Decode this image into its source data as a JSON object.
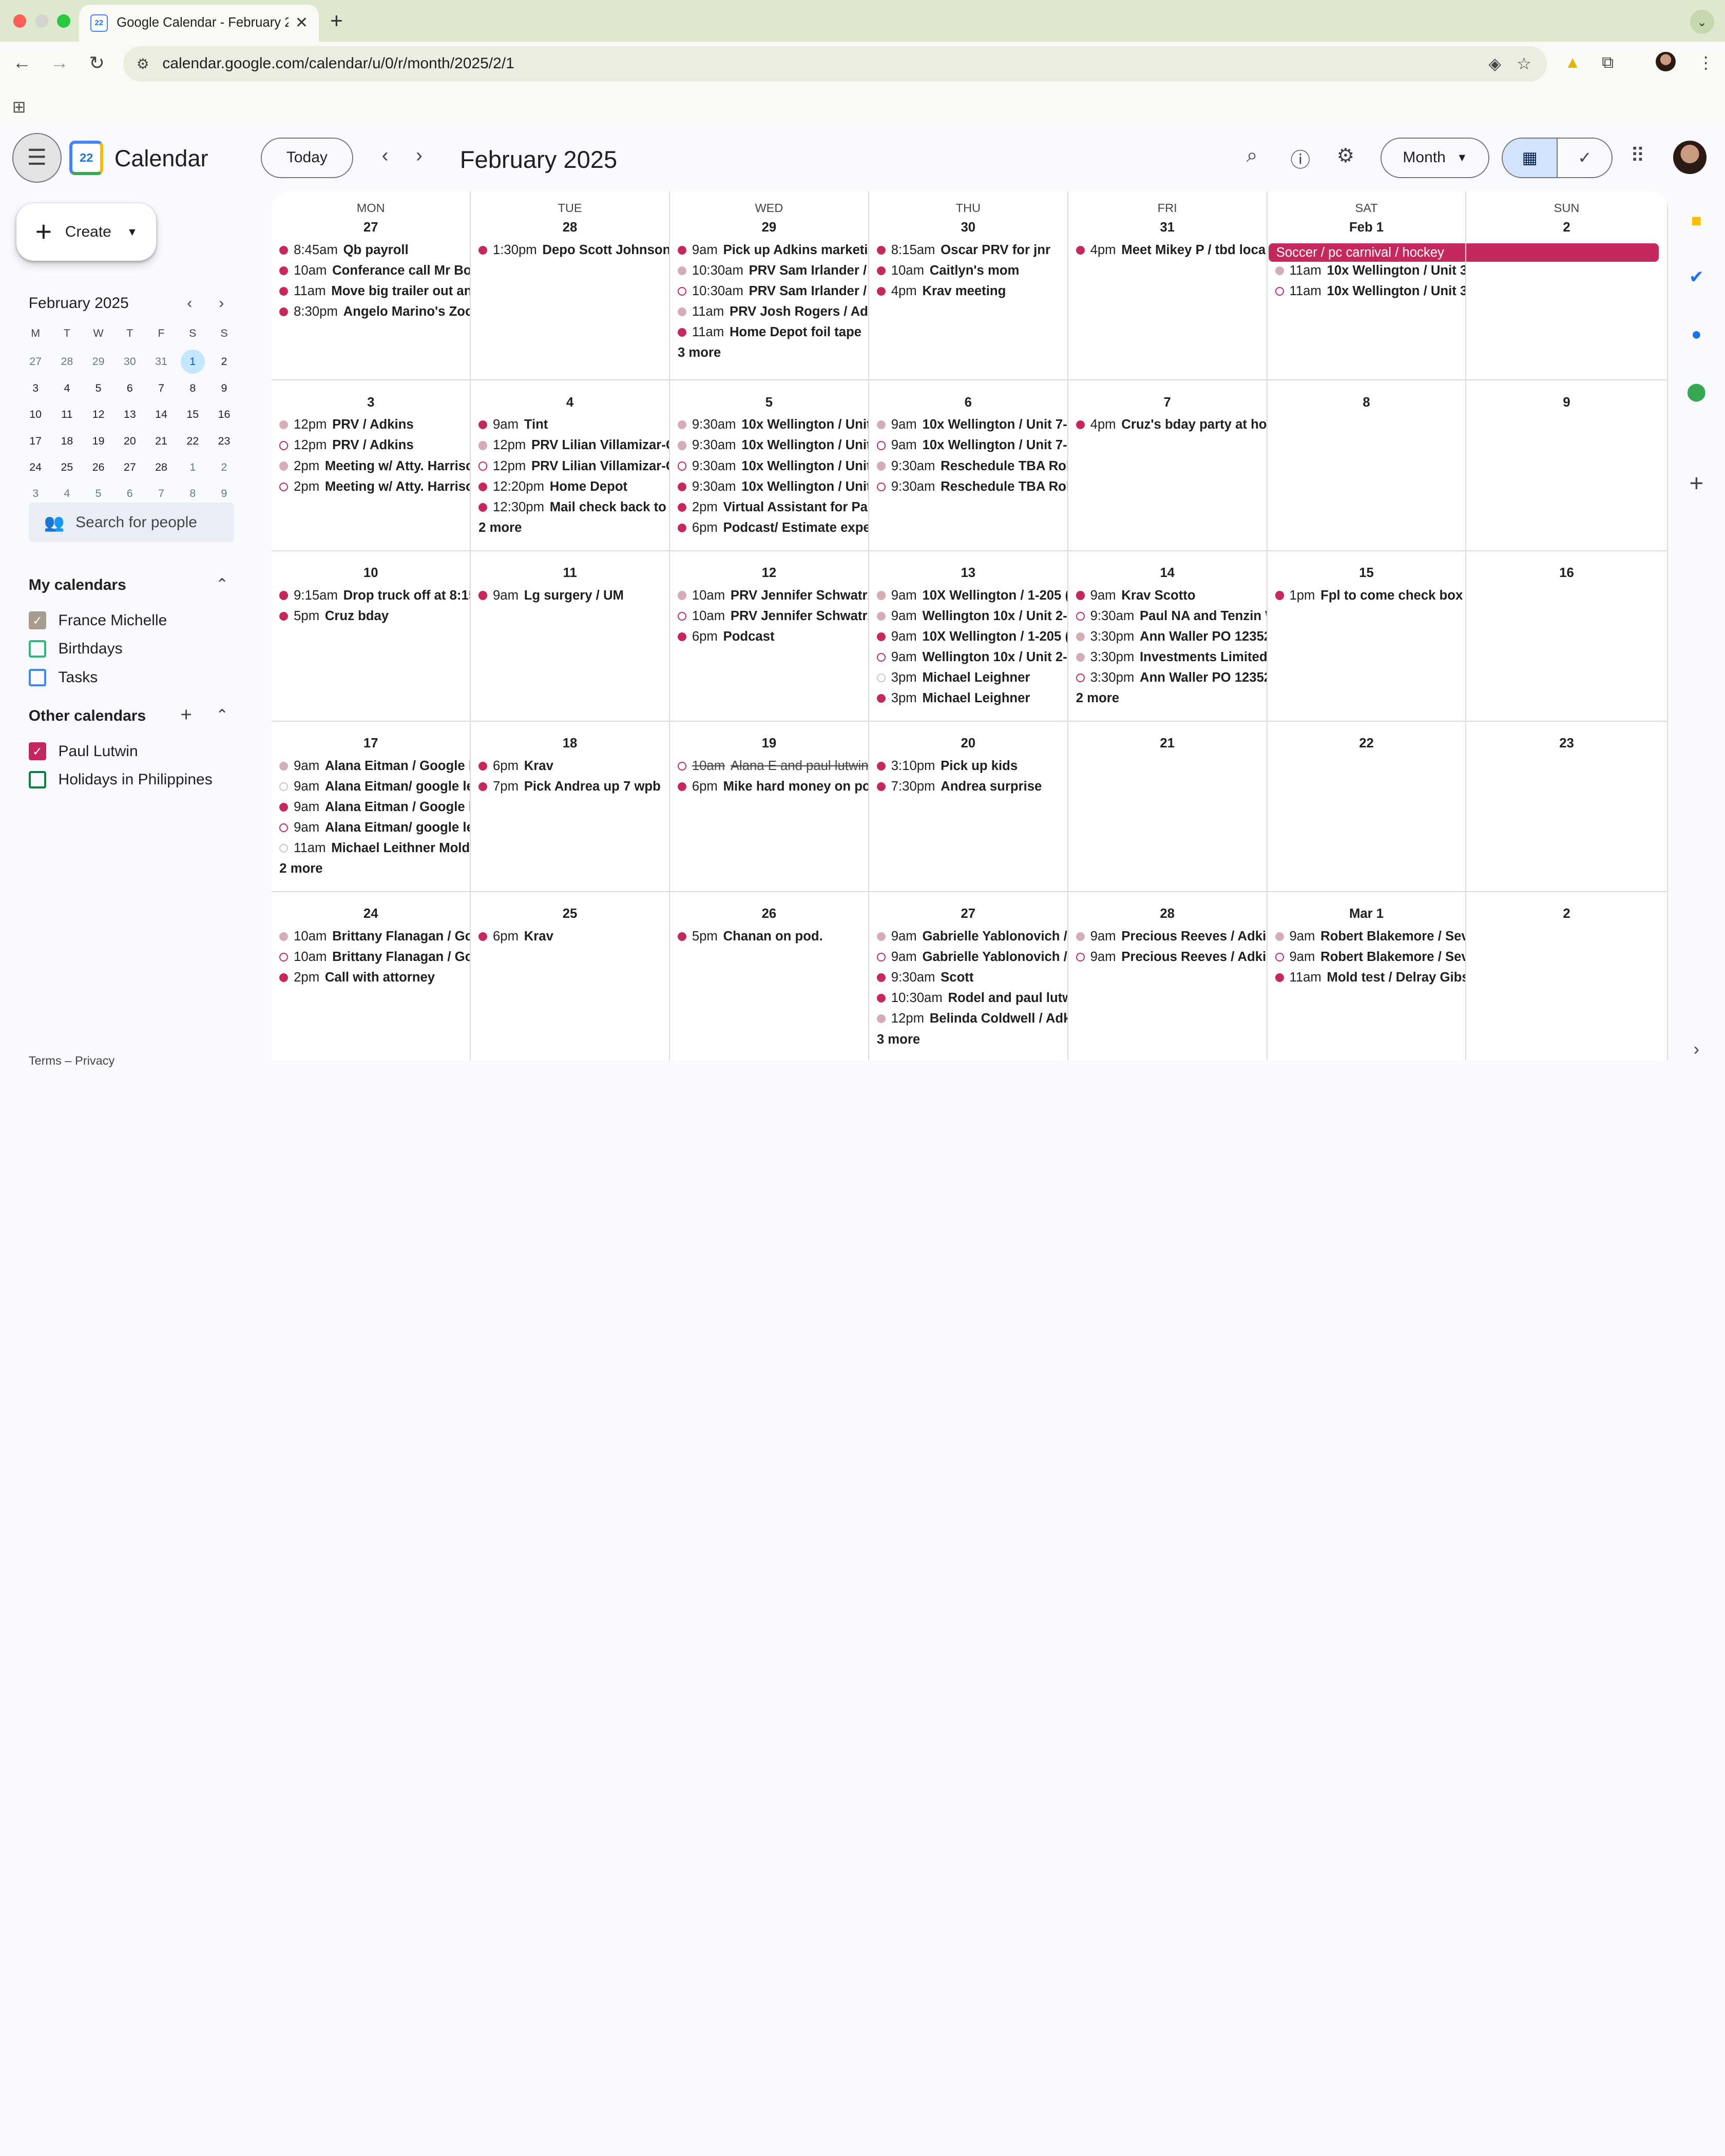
{
  "browser": {
    "tab_title": "Google Calendar - February 2025",
    "tab_favicon": "22",
    "url": "calendar.google.com/calendar/u/0/r/month/2025/2/1"
  },
  "header": {
    "brand": "Calendar",
    "logo_text": "22",
    "today_label": "Today",
    "title": "February 2025",
    "view_label": "Month"
  },
  "sidebar": {
    "create_label": "Create",
    "mini": {
      "title": "February 2025",
      "weekdays": [
        "M",
        "T",
        "W",
        "T",
        "F",
        "S",
        "S"
      ],
      "weeks": [
        [
          "27",
          "28",
          "29",
          "30",
          "31",
          "1",
          "2"
        ],
        [
          "3",
          "4",
          "5",
          "6",
          "7",
          "8",
          "9"
        ],
        [
          "10",
          "11",
          "12",
          "13",
          "14",
          "15",
          "16"
        ],
        [
          "17",
          "18",
          "19",
          "20",
          "21",
          "22",
          "23"
        ],
        [
          "24",
          "25",
          "26",
          "27",
          "28",
          "1",
          "2"
        ],
        [
          "3",
          "4",
          "5",
          "6",
          "7",
          "8",
          "9"
        ]
      ],
      "dim_first_row_count": 5,
      "dim_last_row_from": 5,
      "selected": "1"
    },
    "search_people_placeholder": "Search for people",
    "my_calendars_title": "My calendars",
    "my_calendars": [
      {
        "label": "France Michelle",
        "color": "#a79b8e",
        "checked": true
      },
      {
        "label": "Birthdays",
        "color": "#33b679",
        "checked": false
      },
      {
        "label": "Tasks",
        "color": "#4285f4",
        "checked": false
      }
    ],
    "other_calendars_title": "Other calendars",
    "other_calendars": [
      {
        "label": "Paul Lutwin",
        "color": "#c5285e",
        "checked": true
      },
      {
        "label": "Holidays in Philippines",
        "color": "#0b8043",
        "checked": false
      }
    ],
    "terms": "Terms – Privacy"
  },
  "calendar": {
    "weekdays": [
      "MON",
      "TUE",
      "WED",
      "THU",
      "FRI",
      "SAT",
      "SUN"
    ],
    "banner": "Soccer / pc carnival / hockey",
    "weeks": [
      [
        {
          "day": "27",
          "events": [
            {
              "s": "solid",
              "time": "8:45am",
              "title": "Qb payroll"
            },
            {
              "s": "solid",
              "time": "10am",
              "title": "Conferance call Mr Bo"
            },
            {
              "s": "solid",
              "time": "11am",
              "title": "Move big trailer out an"
            },
            {
              "s": "solid",
              "time": "8:30pm",
              "title": "Angelo Marino's Zoo"
            }
          ]
        },
        {
          "day": "28",
          "events": [
            {
              "s": "solid",
              "time": "1:30pm",
              "title": "Depo Scott Johnson"
            }
          ]
        },
        {
          "day": "29",
          "events": [
            {
              "s": "solid",
              "time": "9am",
              "title": "Pick up Adkins marketin"
            },
            {
              "s": "light",
              "time": "10:30am",
              "title": "PRV Sam Irlander /"
            },
            {
              "s": "hollow",
              "time": "10:30am",
              "title": "PRV Sam Irlander /"
            },
            {
              "s": "light",
              "time": "11am",
              "title": "PRV Josh Rogers / Adki"
            },
            {
              "s": "solid",
              "time": "11am",
              "title": "Home Depot foil tape"
            }
          ],
          "more": "3 more"
        },
        {
          "day": "30",
          "events": [
            {
              "s": "solid",
              "time": "8:15am",
              "title": "Oscar PRV for jnr"
            },
            {
              "s": "solid",
              "time": "10am",
              "title": "Caitlyn's mom"
            },
            {
              "s": "solid",
              "time": "4pm",
              "title": "Krav meeting"
            }
          ]
        },
        {
          "day": "31",
          "events": [
            {
              "s": "solid",
              "time": "4pm",
              "title": "Meet Mikey P / tbd loca"
            }
          ]
        },
        {
          "day": "Feb 1",
          "events": [
            {
              "s": "light",
              "time": "11am",
              "title": "10x Wellington / Unit 3-"
            },
            {
              "s": "hollow",
              "time": "11am",
              "title": "10x Wellington / Unit 3-"
            }
          ]
        },
        {
          "day": "2",
          "events": []
        }
      ],
      [
        {
          "day": "3",
          "events": [
            {
              "s": "light",
              "time": "12pm",
              "title": "PRV / Adkins"
            },
            {
              "s": "hollow",
              "time": "12pm",
              "title": "PRV / Adkins"
            },
            {
              "s": "light",
              "time": "2pm",
              "title": "Meeting w/ Atty. Harriso"
            },
            {
              "s": "hollow",
              "time": "2pm",
              "title": "Meeting w/ Atty. Harriso"
            }
          ]
        },
        {
          "day": "4",
          "events": [
            {
              "s": "solid",
              "time": "9am",
              "title": "Tint"
            },
            {
              "s": "light",
              "time": "12pm",
              "title": "PRV Lilian Villamizar-G"
            },
            {
              "s": "hollow",
              "time": "12pm",
              "title": "PRV Lilian Villamizar-G"
            },
            {
              "s": "solid",
              "time": "12:20pm",
              "title": "Home Depot"
            },
            {
              "s": "solid",
              "time": "12:30pm",
              "title": "Mail check back to"
            }
          ],
          "more": "2 more"
        },
        {
          "day": "5",
          "events": [
            {
              "s": "light",
              "time": "9:30am",
              "title": "10x Wellington / Unit"
            },
            {
              "s": "light",
              "time": "9:30am",
              "title": "10x Wellington / Unit"
            },
            {
              "s": "hollow",
              "time": "9:30am",
              "title": "10x Wellington / Unit"
            },
            {
              "s": "solid",
              "time": "9:30am",
              "title": "10x Wellington / Unit"
            },
            {
              "s": "solid",
              "time": "2pm",
              "title": "Virtual Assistant for Pau"
            },
            {
              "s": "solid",
              "time": "6pm",
              "title": "Podcast/ Estimate expe"
            }
          ]
        },
        {
          "day": "6",
          "events": [
            {
              "s": "light",
              "time": "9am",
              "title": "10x Wellington / Unit 7-1"
            },
            {
              "s": "hollow",
              "time": "9am",
              "title": "10x Wellington / Unit 7-1"
            },
            {
              "s": "light",
              "time": "9:30am",
              "title": "Reschedule TBA Rob"
            },
            {
              "s": "hollow",
              "time": "9:30am",
              "title": "Reschedule TBA Rob"
            }
          ]
        },
        {
          "day": "7",
          "events": [
            {
              "s": "solid",
              "time": "4pm",
              "title": "Cruz's bday party at ho"
            }
          ]
        },
        {
          "day": "8",
          "events": []
        },
        {
          "day": "9",
          "events": []
        }
      ],
      [
        {
          "day": "10",
          "events": [
            {
              "s": "solid",
              "time": "9:15am",
              "title": "Drop truck off at 8:15"
            },
            {
              "s": "solid",
              "time": "5pm",
              "title": "Cruz bday"
            }
          ]
        },
        {
          "day": "11",
          "events": [
            {
              "s": "solid",
              "time": "9am",
              "title": "Lg surgery / UM"
            }
          ]
        },
        {
          "day": "12",
          "events": [
            {
              "s": "light",
              "time": "10am",
              "title": "PRV Jennifer Schwatrz"
            },
            {
              "s": "hollow",
              "time": "10am",
              "title": "PRV Jennifer Schwatrz"
            },
            {
              "s": "solid",
              "time": "6pm",
              "title": "Podcast"
            }
          ]
        },
        {
          "day": "13",
          "events": [
            {
              "s": "light",
              "time": "9am",
              "title": "10X Wellington / 1-205 ("
            },
            {
              "s": "light",
              "time": "9am",
              "title": "Wellington 10x / Unit 2-"
            },
            {
              "s": "solid",
              "time": "9am",
              "title": "10X Wellington / 1-205 ("
            },
            {
              "s": "hollow",
              "time": "9am",
              "title": "Wellington 10x / Unit 2-"
            },
            {
              "s": "hgrey",
              "time": "3pm",
              "title": "Michael Leighner"
            },
            {
              "s": "solid",
              "time": "3pm",
              "title": "Michael Leighner"
            }
          ]
        },
        {
          "day": "14",
          "events": [
            {
              "s": "solid",
              "time": "9am",
              "title": "Krav Scotto"
            },
            {
              "s": "hollow",
              "time": "9:30am",
              "title": "Paul NA and Tenzin W"
            },
            {
              "s": "light",
              "time": "3:30pm",
              "title": "Ann Waller PO 12352"
            },
            {
              "s": "light",
              "time": "3:30pm",
              "title": "Investments Limited"
            },
            {
              "s": "hollow",
              "time": "3:30pm",
              "title": "Ann Waller PO 12352"
            }
          ],
          "more": "2 more"
        },
        {
          "day": "15",
          "events": [
            {
              "s": "solid",
              "time": "1pm",
              "title": "Fpl to come check box a"
            }
          ]
        },
        {
          "day": "16",
          "events": []
        }
      ],
      [
        {
          "day": "17",
          "events": [
            {
              "s": "light",
              "time": "9am",
              "title": "Alana Eitman / Google l"
            },
            {
              "s": "hgrey",
              "time": "9am",
              "title": "Alana Eitman/ google le"
            },
            {
              "s": "solid",
              "time": "9am",
              "title": "Alana Eitman / Google l"
            },
            {
              "s": "hollow",
              "time": "9am",
              "title": "Alana Eitman/ google le"
            },
            {
              "s": "hgrey",
              "time": "11am",
              "title": "Michael Leithner Mold"
            }
          ],
          "more": "2 more"
        },
        {
          "day": "18",
          "events": [
            {
              "s": "solid",
              "time": "6pm",
              "title": "Krav"
            },
            {
              "s": "solid",
              "time": "7pm",
              "title": "Pick Andrea up 7 wpb"
            }
          ]
        },
        {
          "day": "19",
          "events": [
            {
              "s": "hollow",
              "time": "10am",
              "title": "Alana E and paul lutwin",
              "strike": true
            },
            {
              "s": "solid",
              "time": "6pm",
              "title": "Mike hard money on po"
            }
          ]
        },
        {
          "day": "20",
          "events": [
            {
              "s": "solid",
              "time": "3:10pm",
              "title": "Pick up kids"
            },
            {
              "s": "solid",
              "time": "7:30pm",
              "title": "Andrea surprise"
            }
          ]
        },
        {
          "day": "21",
          "events": []
        },
        {
          "day": "22",
          "events": []
        },
        {
          "day": "23",
          "events": []
        }
      ],
      [
        {
          "day": "24",
          "events": [
            {
              "s": "light",
              "time": "10am",
              "title": "Brittany Flanagan / Go"
            },
            {
              "s": "hollow",
              "time": "10am",
              "title": "Brittany Flanagan / Go"
            },
            {
              "s": "solid",
              "time": "2pm",
              "title": "Call with attorney"
            }
          ]
        },
        {
          "day": "25",
          "events": [
            {
              "s": "solid",
              "time": "6pm",
              "title": "Krav"
            }
          ]
        },
        {
          "day": "26",
          "events": [
            {
              "s": "solid",
              "time": "5pm",
              "title": "Chanan on pod."
            }
          ]
        },
        {
          "day": "27",
          "events": [
            {
              "s": "light",
              "time": "9am",
              "title": "Gabrielle Yablonovich /"
            },
            {
              "s": "hollow",
              "time": "9am",
              "title": "Gabrielle Yablonovich /"
            },
            {
              "s": "solid",
              "time": "9:30am",
              "title": "Scott"
            },
            {
              "s": "solid",
              "time": "10:30am",
              "title": "Rodel and paul lutw"
            },
            {
              "s": "light",
              "time": "12pm",
              "title": "Belinda Coldwell / Adk"
            }
          ],
          "more": "3 more"
        },
        {
          "day": "28",
          "events": [
            {
              "s": "light",
              "time": "9am",
              "title": "Precious Reeves / Adkir"
            },
            {
              "s": "hollow",
              "time": "9am",
              "title": "Precious Reeves / Adkir"
            }
          ]
        },
        {
          "day": "Mar 1",
          "events": [
            {
              "s": "light",
              "time": "9am",
              "title": "Robert Blakemore / Sev"
            },
            {
              "s": "hollow",
              "time": "9am",
              "title": "Robert Blakemore / Sev"
            },
            {
              "s": "solid",
              "time": "11am",
              "title": "Mold test / Delray Gibs"
            }
          ]
        },
        {
          "day": "2",
          "events": []
        }
      ]
    ]
  },
  "colors": {
    "event": "#c5285e",
    "event_light": "#d4adb7",
    "selected_day": "#c2e7ff",
    "view_toggle": "#d3e3fd"
  }
}
